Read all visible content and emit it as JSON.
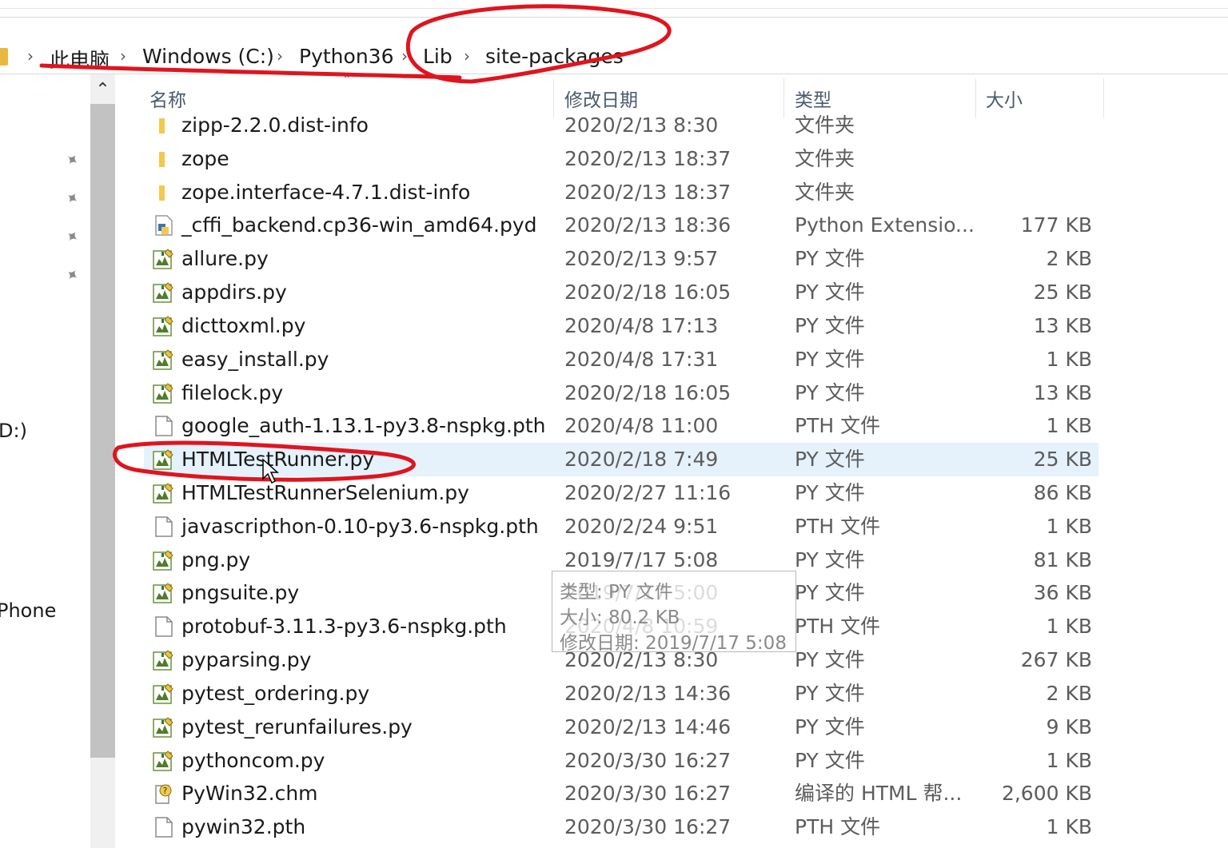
{
  "breadcrumb": {
    "items": [
      "此电脑",
      "Windows (C:)",
      "Python36",
      "Lib",
      "site-packages"
    ]
  },
  "nav_pane": {
    "drive_label": "D:)",
    "phone_label": "Phone"
  },
  "columns": {
    "name": "名称",
    "date": "修改日期",
    "type": "类型",
    "size": "大小"
  },
  "files": [
    {
      "name": "zipp-2.2.0.dist-info",
      "date": "2020/2/13 8:30",
      "type": "文件夹",
      "size": "",
      "icon": "folder-icon"
    },
    {
      "name": "zope",
      "date": "2020/2/13 18:37",
      "type": "文件夹",
      "size": "",
      "icon": "folder-icon"
    },
    {
      "name": "zope.interface-4.7.1.dist-info",
      "date": "2020/2/13 18:37",
      "type": "文件夹",
      "size": "",
      "icon": "folder-icon"
    },
    {
      "name": "_cffi_backend.cp36-win_amd64.pyd",
      "date": "2020/2/13 18:36",
      "type": "Python Extensio...",
      "size": "177 KB",
      "icon": "pyd-file-icon"
    },
    {
      "name": "allure.py",
      "date": "2020/2/13 9:57",
      "type": "PY 文件",
      "size": "2 KB",
      "icon": "py-file-icon"
    },
    {
      "name": "appdirs.py",
      "date": "2020/2/18 16:05",
      "type": "PY 文件",
      "size": "25 KB",
      "icon": "py-file-icon"
    },
    {
      "name": "dicttoxml.py",
      "date": "2020/4/8 17:13",
      "type": "PY 文件",
      "size": "13 KB",
      "icon": "py-file-icon"
    },
    {
      "name": "easy_install.py",
      "date": "2020/4/8 17:31",
      "type": "PY 文件",
      "size": "1 KB",
      "icon": "py-file-icon"
    },
    {
      "name": "filelock.py",
      "date": "2020/2/18 16:05",
      "type": "PY 文件",
      "size": "13 KB",
      "icon": "py-file-icon"
    },
    {
      "name": "google_auth-1.13.1-py3.8-nspkg.pth",
      "date": "2020/4/8 11:00",
      "type": "PTH 文件",
      "size": "1 KB",
      "icon": "blank-file-icon"
    },
    {
      "name": "HTMLTestRunner.py",
      "date": "2020/2/18 7:49",
      "type": "PY 文件",
      "size": "25 KB",
      "icon": "py-file-icon",
      "selected": true
    },
    {
      "name": "HTMLTestRunnerSelenium.py",
      "date": "2020/2/27 11:16",
      "type": "PY 文件",
      "size": "86 KB",
      "icon": "py-file-icon"
    },
    {
      "name": "javascripthon-0.10-py3.6-nspkg.pth",
      "date": "2020/2/24 9:51",
      "type": "PTH 文件",
      "size": "1 KB",
      "icon": "blank-file-icon"
    },
    {
      "name": "png.py",
      "date": "2019/7/17 5:08",
      "type": "PY 文件",
      "size": "81 KB",
      "icon": "py-file-icon"
    },
    {
      "name": "pngsuite.py",
      "date": "2019/7/17 5:00",
      "type": "PY 文件",
      "size": "36 KB",
      "icon": "py-file-icon"
    },
    {
      "name": "protobuf-3.11.3-py3.6-nspkg.pth",
      "date": "2020/4/8 10:59",
      "type": "PTH 文件",
      "size": "1 KB",
      "icon": "blank-file-icon"
    },
    {
      "name": "pyparsing.py",
      "date": "2020/2/13 8:30",
      "type": "PY 文件",
      "size": "267 KB",
      "icon": "py-file-icon"
    },
    {
      "name": "pytest_ordering.py",
      "date": "2020/2/13 14:36",
      "type": "PY 文件",
      "size": "2 KB",
      "icon": "py-file-icon"
    },
    {
      "name": "pytest_rerunfailures.py",
      "date": "2020/2/13 14:46",
      "type": "PY 文件",
      "size": "9 KB",
      "icon": "py-file-icon"
    },
    {
      "name": "pythoncom.py",
      "date": "2020/3/30 16:27",
      "type": "PY 文件",
      "size": "1 KB",
      "icon": "py-file-icon"
    },
    {
      "name": "PyWin32.chm",
      "date": "2020/3/30 16:27",
      "type": "编译的 HTML 帮...",
      "size": "2,600 KB",
      "icon": "chm-help-icon"
    },
    {
      "name": "pywin32.pth",
      "date": "2020/3/30 16:27",
      "type": "PTH 文件",
      "size": "1 KB",
      "icon": "blank-file-icon"
    }
  ],
  "tooltip": {
    "type_line": "类型: PY 文件",
    "size_line": "大小: 80.2 KB",
    "date_line": "修改日期: 2019/7/17 5:08"
  },
  "colors": {
    "selection": "#e5f1fb",
    "annotation_red": "#e0141e",
    "folder": "#e8b93e"
  }
}
